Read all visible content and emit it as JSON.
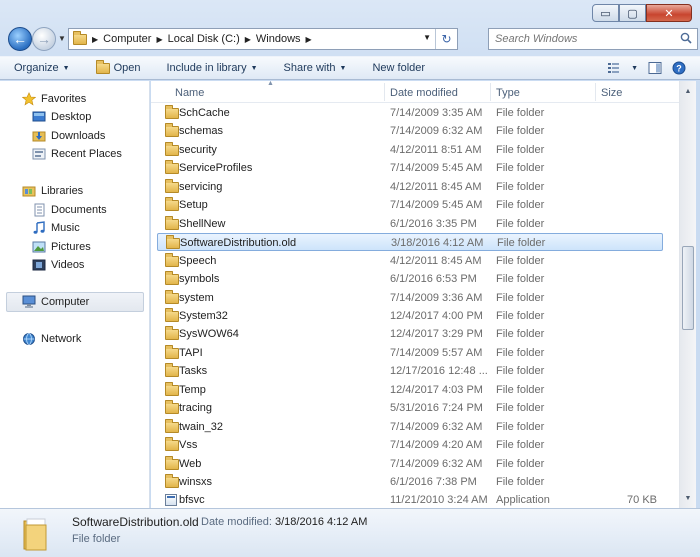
{
  "window": {
    "caption_buttons": {
      "minimize": "▭",
      "maximize": "▢",
      "close": "✕"
    }
  },
  "address_bar": {
    "breadcrumbs": [
      "Computer",
      "Local Disk (C:)",
      "Windows"
    ],
    "search_placeholder": "Search Windows"
  },
  "toolbar": {
    "organize": "Organize",
    "open": "Open",
    "include_in_library": "Include in library",
    "share_with": "Share with",
    "new_folder": "New folder"
  },
  "nav_pane": {
    "favorites": "Favorites",
    "desktop": "Desktop",
    "downloads": "Downloads",
    "recent_places": "Recent Places",
    "libraries": "Libraries",
    "documents": "Documents",
    "music": "Music",
    "pictures": "Pictures",
    "videos": "Videos",
    "computer": "Computer",
    "network": "Network"
  },
  "columns": {
    "name": "Name",
    "date_modified": "Date modified",
    "type": "Type",
    "size": "Size"
  },
  "files": [
    {
      "name": "SchCache",
      "date": "7/14/2009 3:35 AM",
      "type": "File folder",
      "size": "",
      "kind": "folder"
    },
    {
      "name": "schemas",
      "date": "7/14/2009 6:32 AM",
      "type": "File folder",
      "size": "",
      "kind": "folder"
    },
    {
      "name": "security",
      "date": "4/12/2011 8:51 AM",
      "type": "File folder",
      "size": "",
      "kind": "folder"
    },
    {
      "name": "ServiceProfiles",
      "date": "7/14/2009 5:45 AM",
      "type": "File folder",
      "size": "",
      "kind": "folder"
    },
    {
      "name": "servicing",
      "date": "4/12/2011 8:45 AM",
      "type": "File folder",
      "size": "",
      "kind": "folder"
    },
    {
      "name": "Setup",
      "date": "7/14/2009 5:45 AM",
      "type": "File folder",
      "size": "",
      "kind": "folder"
    },
    {
      "name": "ShellNew",
      "date": "6/1/2016 3:35 PM",
      "type": "File folder",
      "size": "",
      "kind": "folder"
    },
    {
      "name": "SoftwareDistribution.old",
      "date": "3/18/2016 4:12 AM",
      "type": "File folder",
      "size": "",
      "kind": "folder",
      "selected": true
    },
    {
      "name": "Speech",
      "date": "4/12/2011 8:45 AM",
      "type": "File folder",
      "size": "",
      "kind": "folder"
    },
    {
      "name": "symbols",
      "date": "6/1/2016 6:53 PM",
      "type": "File folder",
      "size": "",
      "kind": "folder"
    },
    {
      "name": "system",
      "date": "7/14/2009 3:36 AM",
      "type": "File folder",
      "size": "",
      "kind": "folder"
    },
    {
      "name": "System32",
      "date": "12/4/2017 4:00 PM",
      "type": "File folder",
      "size": "",
      "kind": "folder"
    },
    {
      "name": "SysWOW64",
      "date": "12/4/2017 3:29 PM",
      "type": "File folder",
      "size": "",
      "kind": "folder"
    },
    {
      "name": "TAPI",
      "date": "7/14/2009 5:57 AM",
      "type": "File folder",
      "size": "",
      "kind": "folder"
    },
    {
      "name": "Tasks",
      "date": "12/17/2016 12:48 ...",
      "type": "File folder",
      "size": "",
      "kind": "folder"
    },
    {
      "name": "Temp",
      "date": "12/4/2017 4:03 PM",
      "type": "File folder",
      "size": "",
      "kind": "folder"
    },
    {
      "name": "tracing",
      "date": "5/31/2016 7:24 PM",
      "type": "File folder",
      "size": "",
      "kind": "folder"
    },
    {
      "name": "twain_32",
      "date": "7/14/2009 6:32 AM",
      "type": "File folder",
      "size": "",
      "kind": "folder"
    },
    {
      "name": "Vss",
      "date": "7/14/2009 4:20 AM",
      "type": "File folder",
      "size": "",
      "kind": "folder"
    },
    {
      "name": "Web",
      "date": "7/14/2009 6:32 AM",
      "type": "File folder",
      "size": "",
      "kind": "folder"
    },
    {
      "name": "winsxs",
      "date": "6/1/2016 7:38 PM",
      "type": "File folder",
      "size": "",
      "kind": "folder"
    },
    {
      "name": "bfsvc",
      "date": "11/21/2010 3:24 AM",
      "type": "Application",
      "size": "70 KB",
      "kind": "application"
    }
  ],
  "details_pane": {
    "name": "SoftwareDistribution.old",
    "date_label": "Date modified:",
    "date_value": "3/18/2016 4:12 AM",
    "type": "File folder"
  }
}
